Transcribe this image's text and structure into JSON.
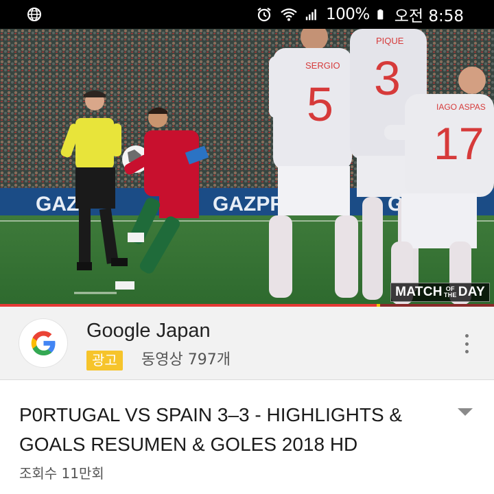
{
  "status_bar": {
    "icons": [
      "globe-icon",
      "alarm-icon",
      "wifi-icon",
      "signal-icon",
      "battery-icon"
    ],
    "battery_percent": "100%",
    "time": "오전 8:58"
  },
  "video": {
    "description_icons": [
      "video-thumbnail"
    ],
    "watermark": {
      "part1": "MATCH",
      "part2_top": "OF",
      "part2_bottom": "THE",
      "part3": "DAY"
    },
    "progress": 0.764,
    "progress_marker": 0.762,
    "jersey_names": [
      "SERGIO",
      "PIQUE",
      "IAGO ASPAS"
    ],
    "jersey_numbers": [
      "5",
      "3",
      "17"
    ],
    "board_texts": [
      "GAZP",
      "GAZPROM",
      "G"
    ]
  },
  "channel": {
    "name": "Google Japan",
    "ad_label": "광고",
    "video_count": "동영상 797개",
    "avatar_icon": "google-g-icon",
    "more_icon": "more-vert-icon"
  },
  "content": {
    "title": "P0RTUGAL VS SPAIN 3–3 - HIGHLIGHTS & GOALS RESUMEN & GOLES 2018 HD",
    "views": "조회수 11만회",
    "expand_icon": "expand-chevron-icon"
  },
  "colors": {
    "accent_red": "#e53935",
    "ad_yellow": "#f6c42b",
    "google_blue": "#4285F4",
    "google_red": "#EA4335",
    "google_yellow": "#FBBC05",
    "google_green": "#34A853"
  }
}
